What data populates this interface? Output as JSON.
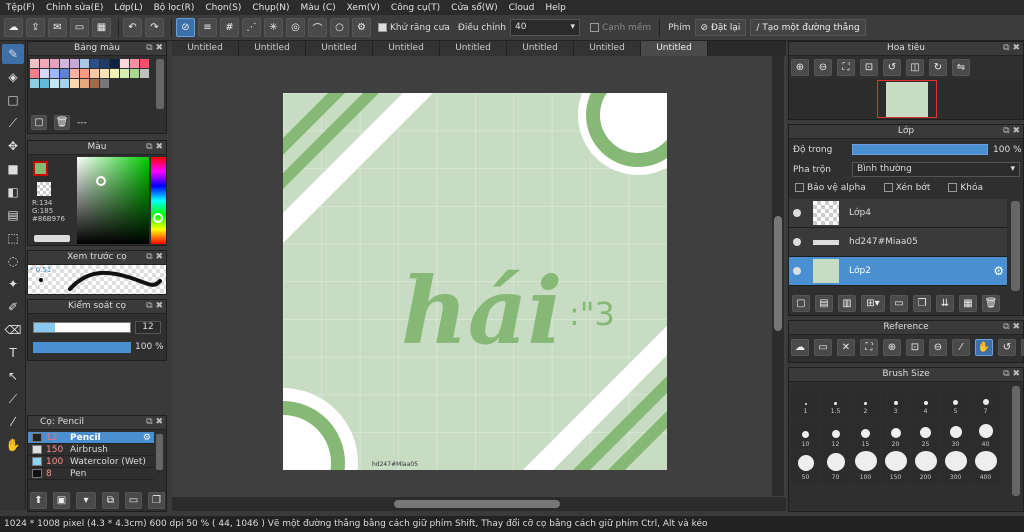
{
  "menu": [
    "Tệp(F)",
    "Chỉnh sửa(E)",
    "Lớp(L)",
    "Bộ lọc(R)",
    "Chọn(S)",
    "Chụp(N)",
    "Màu (C)",
    "Xem(V)",
    "Công cụ(T)",
    "Cửa sổ(W)",
    "Cloud",
    "Help"
  ],
  "toolbar": {
    "antialias_label": "Khử răng cưa",
    "adjust_label": "Điều chỉnh",
    "adjust_value": "40",
    "smooth_label": "Cạnh mềm",
    "key_label": "Phím",
    "reset_label": "Đặt lại",
    "straight_label": "Tạo một đường thẳng"
  },
  "tabs": [
    "Untitled",
    "Untitled",
    "Untitled",
    "Untitled",
    "Untitled",
    "Untitled",
    "Untitled",
    "Untitled"
  ],
  "palette": {
    "title": "Bảng màu",
    "footer": "---",
    "swatches": [
      "#f4c0c8",
      "#f2a6b6",
      "#e7a1c0",
      "#d4b5e0",
      "#c7a6d8",
      "#a9c4e8",
      "#2b4f8a",
      "#1f3b6b",
      "#0d2240",
      "#f8d7dd",
      "#ff8fa3",
      "#ff4f6a",
      "#ff7b8e",
      "#d6d6f5",
      "#a0b8ff",
      "#5c84d6",
      "#ffb0a0",
      "#ff9980",
      "#f9c7a1",
      "#f7e3b5",
      "#f2f2b0",
      "#d6efb0",
      "#a8d88e",
      "#c0c0c0",
      "#8ad0e0",
      "#62b9d8",
      "#c6e8f5",
      "#a3d4e8",
      "#ffd8b0",
      "#e6a97c",
      "#a56a4b",
      "#777777"
    ]
  },
  "color": {
    "title": "Màu",
    "r": "R:134",
    "g": "G:185",
    "hex": "#86B976",
    "current": "#86b976"
  },
  "preview": {
    "title": "Xem trước cọ",
    "size": "0.51"
  },
  "control": {
    "title": "Kiểm soát cọ",
    "size": "12",
    "opacity": "100 %"
  },
  "brushes": {
    "title": "Cọ: Pencil",
    "items": [
      {
        "size": "12",
        "name": "Pencil",
        "color": "#222222",
        "active": true
      },
      {
        "size": "150",
        "name": "Airbrush",
        "color": "#dddddd",
        "active": false
      },
      {
        "size": "100",
        "name": "Watercolor (Wet)",
        "color": "#8fd3f5",
        "active": false
      },
      {
        "size": "8",
        "name": "Pen",
        "color": "#111111",
        "active": false
      }
    ]
  },
  "navigator": {
    "title": "Hoa tiêu"
  },
  "layers": {
    "title": "Lớp",
    "opacity_label": "Độ trong",
    "opacity_value": "100 %",
    "blend_label": "Pha trộn",
    "blend_value": "Bình thường",
    "protect_alpha": "Bảo vệ alpha",
    "clip": "Xén bớt",
    "lock": "Khóa",
    "items": [
      {
        "name": "Lớp4",
        "selected": false
      },
      {
        "name": "hd247#Miaa05",
        "selected": false
      },
      {
        "name": "Lớp2",
        "selected": true
      }
    ]
  },
  "reference": {
    "title": "Reference"
  },
  "brush_size": {
    "title": "Brush Size",
    "sizes": [
      "1",
      "1.5",
      "2",
      "3",
      "4",
      "5",
      "7",
      "10",
      "12",
      "15",
      "20",
      "25",
      "30",
      "40",
      "50",
      "70",
      "100",
      "150",
      "200",
      "300",
      "400"
    ]
  },
  "artwork": {
    "main_text": "hái",
    "suffix": ":\"3",
    "signature": "hd247#Miaa05",
    "bg": "#c8dcc4",
    "accent": "#86b976"
  },
  "status": "1024 * 1008 pixel  (4.3 * 4.3cm)  600 dpi  50 %  ( 44, 1046 )  Vẽ một đường thẳng bằng cách giữ phím Shift, Thay đổi cỡ cọ bằng cách giữ phím Ctrl, Alt và kéo"
}
